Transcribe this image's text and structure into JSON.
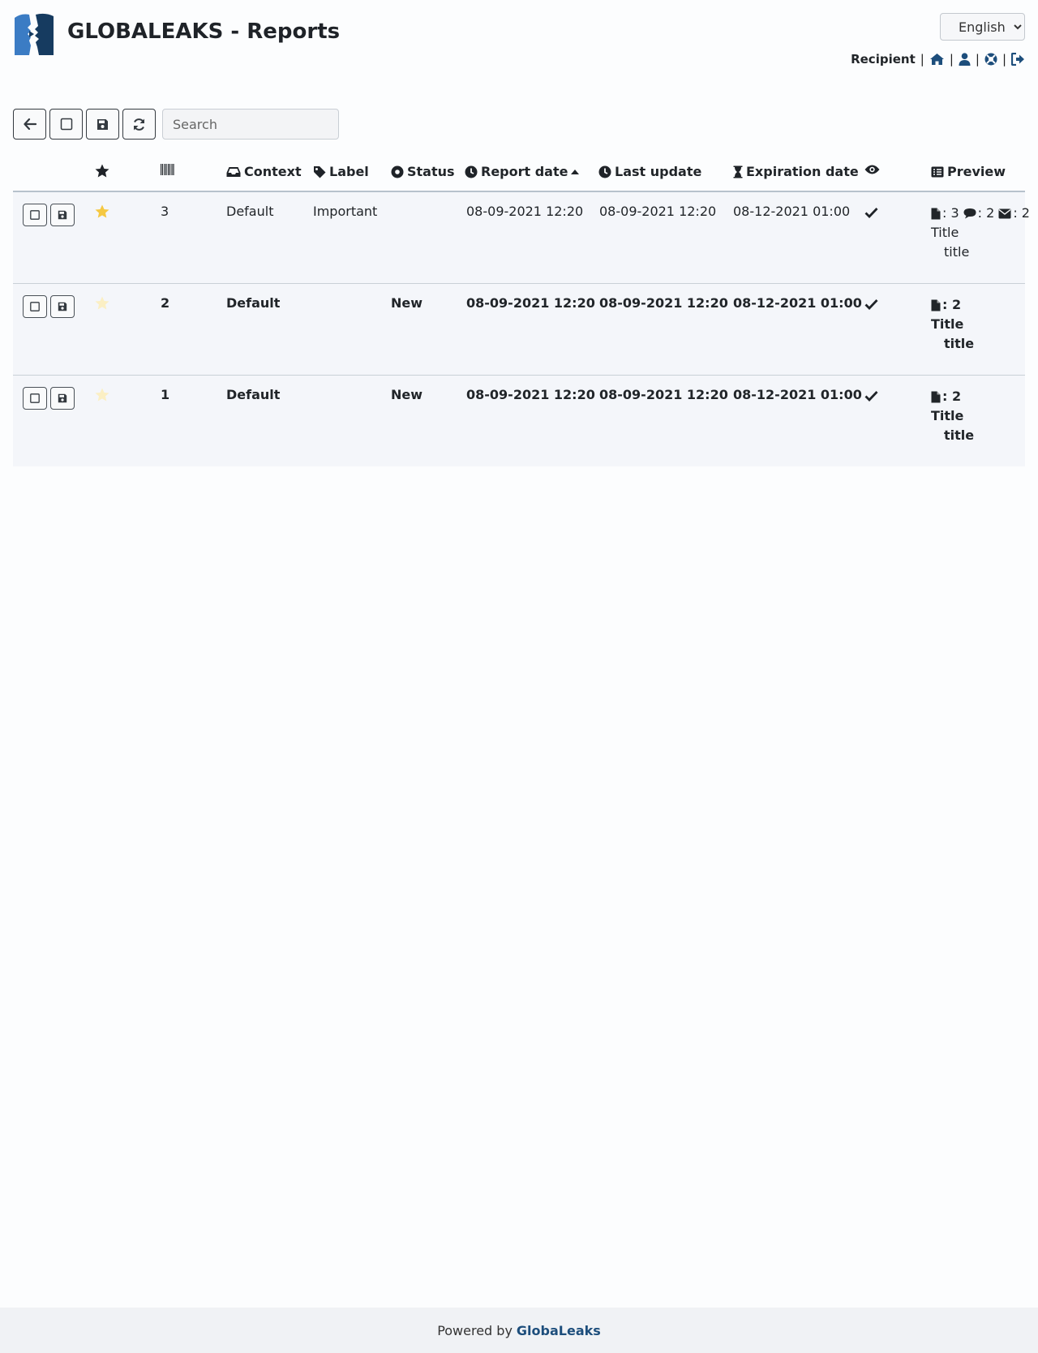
{
  "header": {
    "title": "GLOBALEAKS - Reports",
    "language": "English",
    "languages": [
      "English"
    ],
    "role": "Recipient",
    "separator": "|",
    "nav_icons": [
      "home-icon",
      "user-icon",
      "support-icon",
      "logout-icon"
    ]
  },
  "toolbar": {
    "buttons": [
      "back-icon",
      "select-all-icon",
      "save-icon",
      "refresh-icon"
    ],
    "search_placeholder": "Search"
  },
  "table": {
    "columns": {
      "important": "",
      "id": "",
      "context": "Context",
      "label": "Label",
      "status": "Status",
      "report_date": "Report date",
      "last_update": "Last update",
      "expiration_date": "Expiration date",
      "read": "",
      "preview": "Preview"
    },
    "sort_indicator": "caret-up-icon",
    "rows": [
      {
        "id": "3",
        "important": true,
        "unread": false,
        "context": "Default",
        "label": "Important",
        "status": "",
        "report_date": "08-09-2021 12:20",
        "last_update": "08-09-2021 12:20",
        "expiration_date": "08-12-2021 01:00",
        "files": ": 3",
        "comments": ": 2",
        "messages": ": 2",
        "preview_label": "Title",
        "preview_value": "title"
      },
      {
        "id": "2",
        "important": false,
        "unread": true,
        "context": "Default",
        "label": "",
        "status": "New",
        "report_date": "08-09-2021 12:20",
        "last_update": "08-09-2021 12:20",
        "expiration_date": "08-12-2021 01:00",
        "files": ": 2",
        "preview_label": "Title",
        "preview_value": "title"
      },
      {
        "id": "1",
        "important": false,
        "unread": true,
        "context": "Default",
        "label": "",
        "status": "New",
        "report_date": "08-09-2021 12:20",
        "last_update": "08-09-2021 12:20",
        "expiration_date": "08-12-2021 01:00",
        "files": ": 2",
        "preview_label": "Title",
        "preview_value": "title"
      }
    ]
  },
  "footer": {
    "prefix": "Powered by",
    "brand": "GlobaLeaks"
  },
  "colors": {
    "brand": "#1d4e7c",
    "star_active": "#f5c842",
    "star_inactive": "#fbefc4"
  }
}
